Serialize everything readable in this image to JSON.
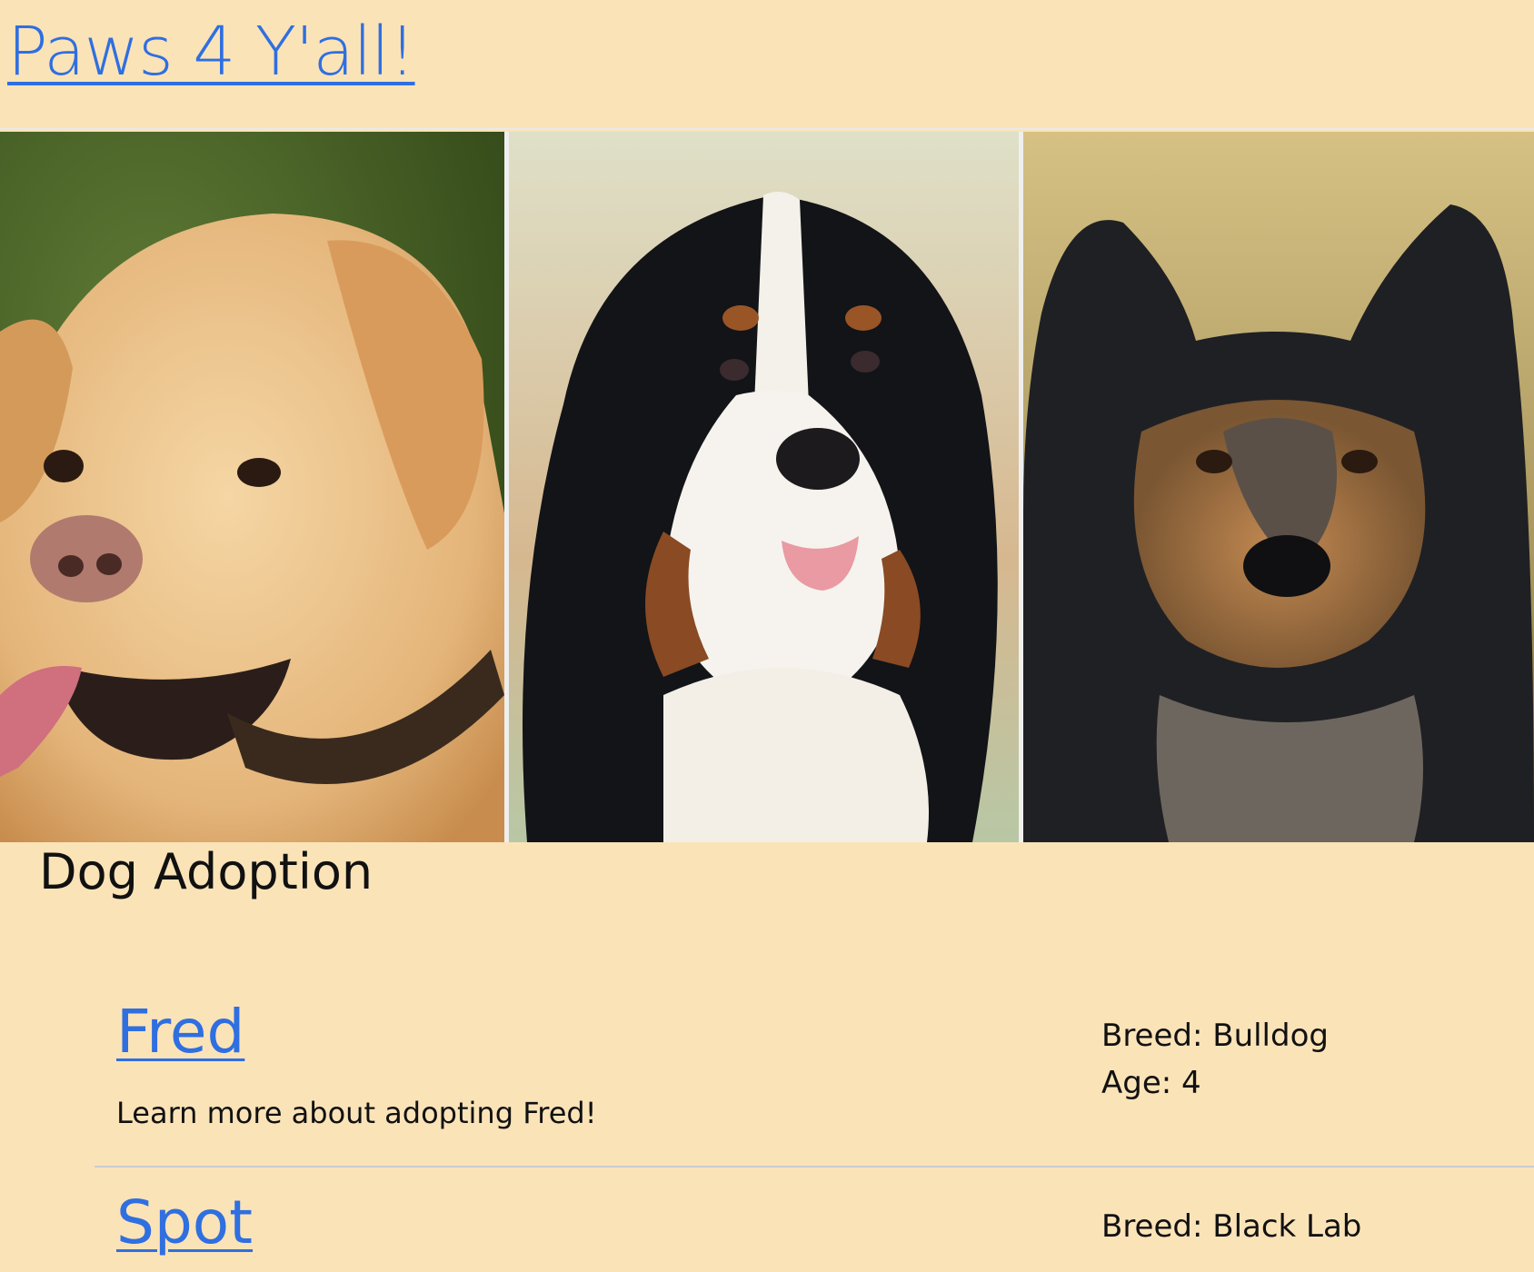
{
  "site": {
    "title": "Paws 4 Y'all!"
  },
  "gallery": {
    "photos": [
      {
        "icon": "yellow-lab-photo"
      },
      {
        "icon": "bernese-mountain-dog-photo"
      },
      {
        "icon": "sheltie-photo"
      }
    ]
  },
  "main": {
    "heading": "Dog Adoption",
    "dogs": [
      {
        "name": "Fred",
        "description": "Learn more about adopting Fred!",
        "breed": "Breed: Bulldog",
        "age": "Age: 4"
      },
      {
        "name": "Spot",
        "breed": "Breed: Black Lab"
      }
    ]
  },
  "colors": {
    "background": "#fbe3b8",
    "link": "#2f6fe0"
  }
}
